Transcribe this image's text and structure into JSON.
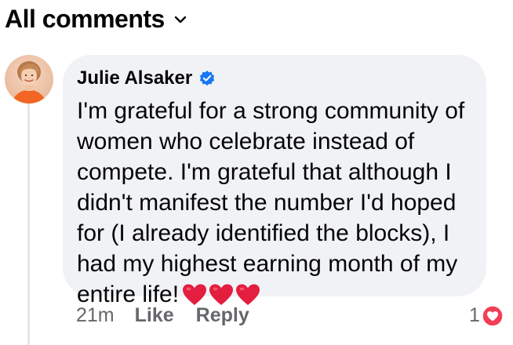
{
  "header": {
    "sort_label": "All comments",
    "sort_icon": "chevron-down-icon"
  },
  "comment": {
    "author": "Julie Alsaker",
    "verified_icon": "verified-badge-icon",
    "text": "I'm grateful for a strong community of women who celebrate instead of compete. I'm grateful that although I didn't manifest the number I'd hoped for (I already identified the blocks), I had my highest earning month of my entire life!",
    "emoji": [
      "heart",
      "heart",
      "heart"
    ],
    "time": "21m",
    "like_label": "Like",
    "reply_label": "Reply",
    "reaction_count": "1",
    "reaction_icon": "love-reaction-icon"
  },
  "colors": {
    "bubble": "#f0f2f5",
    "text": "#050505",
    "meta": "#65676b",
    "verified": "#1877f2",
    "heart": "#e41e3f",
    "reaction": "#f33e58",
    "thread_line": "#e4e6eb"
  }
}
